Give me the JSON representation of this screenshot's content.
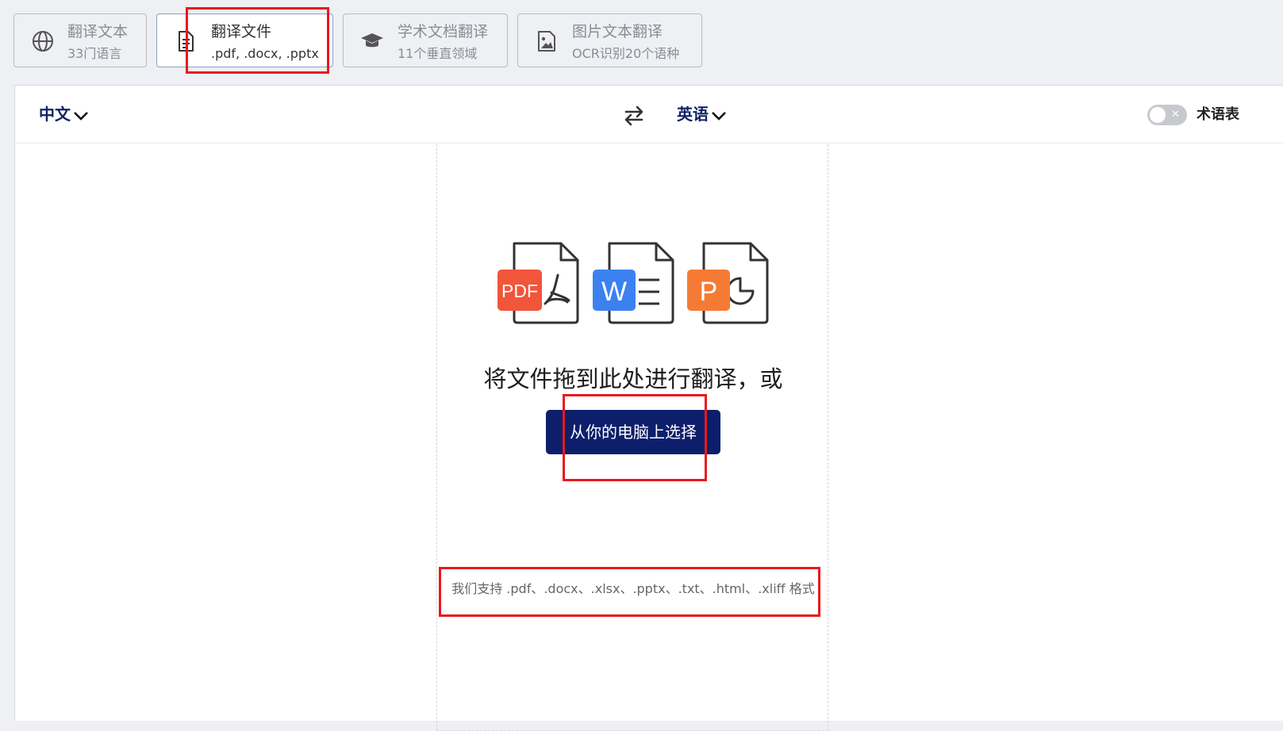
{
  "tabs": [
    {
      "title": "翻译文本",
      "subtitle": "33门语言",
      "icon": "globe-icon",
      "active": false
    },
    {
      "title": "翻译文件",
      "subtitle": ".pdf, .docx, .pptx",
      "icon": "document-icon",
      "active": true
    },
    {
      "title": "学术文档翻译",
      "subtitle": "11个垂直领域",
      "icon": "graduation-cap-icon",
      "active": false
    },
    {
      "title": "图片文本翻译",
      "subtitle": "OCR识别20个语种",
      "icon": "image-icon",
      "active": false
    }
  ],
  "language_bar": {
    "source_language": "中文",
    "target_language": "英语",
    "swap_icon": "swap-arrows-icon",
    "glossary_label": "术语表",
    "glossary_toggle_on": false
  },
  "dropzone": {
    "file_types": [
      {
        "badge": "PDF",
        "color": "#f1553a",
        "icon": "pdf-file-icon"
      },
      {
        "badge": "W",
        "color": "#3b82f0",
        "icon": "word-file-icon"
      },
      {
        "badge": "P",
        "color": "#f57b34",
        "icon": "powerpoint-file-icon"
      }
    ],
    "drop_text": "将文件拖到此处进行翻译，或",
    "choose_button": "从你的电脑上选择",
    "support_text": "我们支持 .pdf、.docx、.xlsx、.pptx、.txt、.html、.xliff 格式"
  },
  "colors": {
    "brand_navy": "#0d1f6b",
    "highlight_red": "#e8191d"
  }
}
